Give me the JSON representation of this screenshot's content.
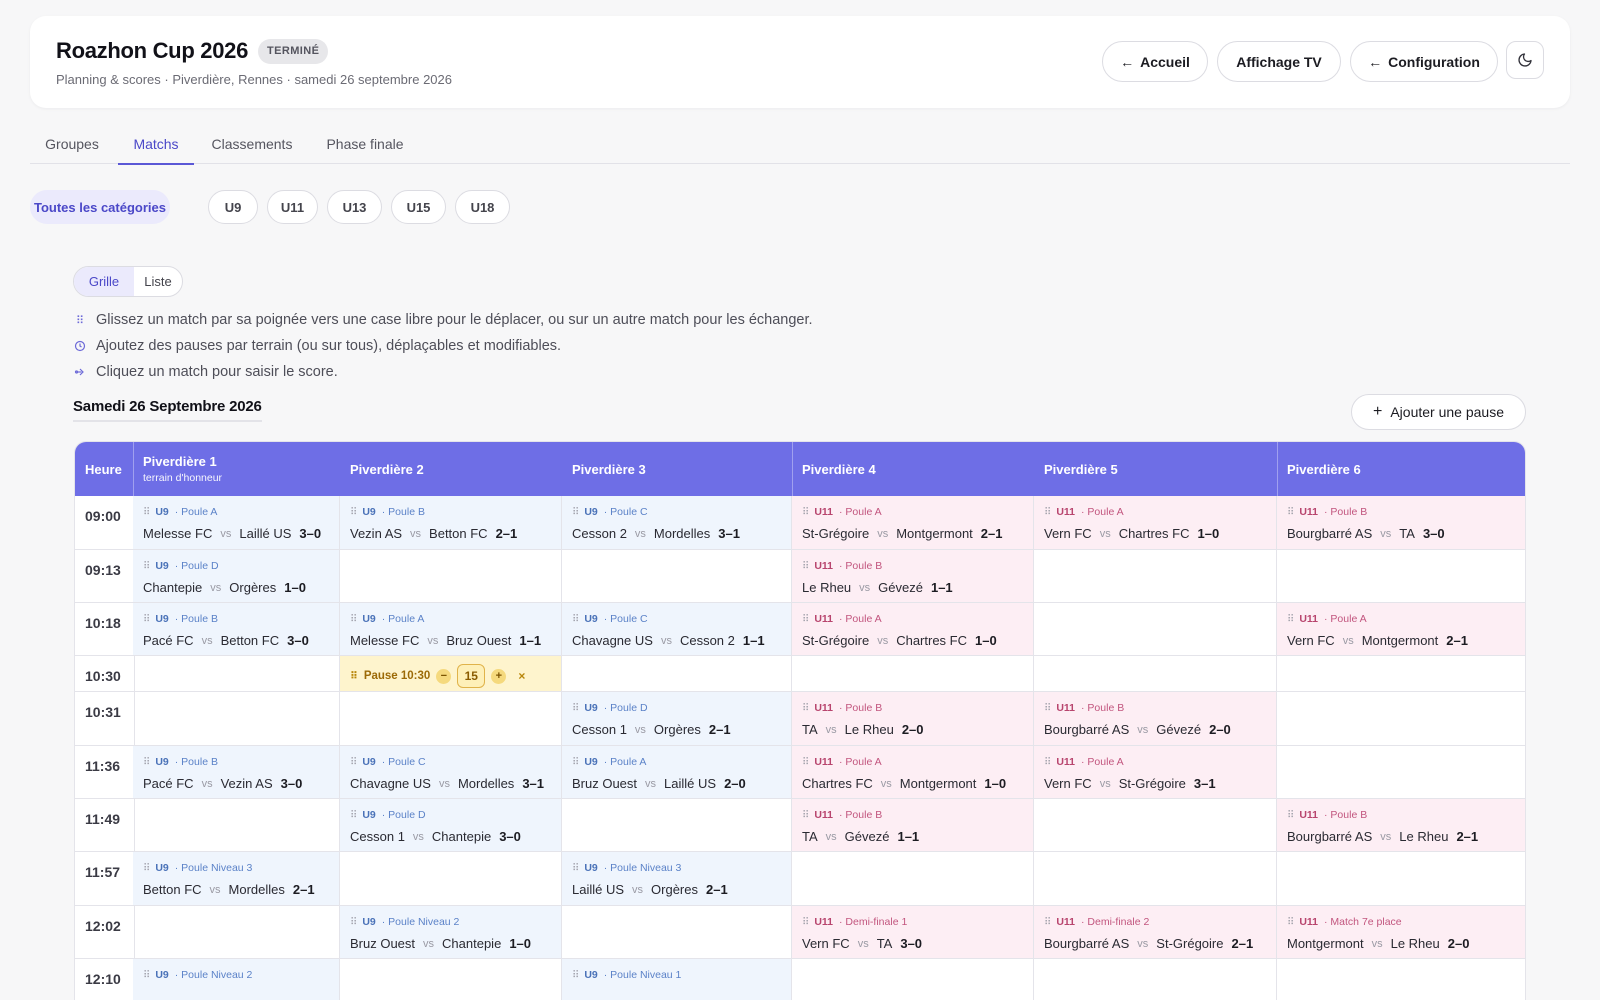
{
  "header": {
    "title": "Roazhon Cup 2026",
    "status": "TERMINÉ",
    "subtitle": "Planning & scores · Piverdière, Rennes · samedi 26 septembre 2026",
    "btn_home": "Accueil",
    "btn_tv": "Affichage TV",
    "btn_config": "Configuration",
    "theme_icon": "moon-icon"
  },
  "tabs": [
    "Groupes",
    "Matchs",
    "Classements",
    "Phase finale"
  ],
  "active_tab": "Matchs",
  "categories": [
    "Toutes les catégories",
    "U9",
    "U11",
    "U13",
    "U15",
    "U18"
  ],
  "view_toggle": {
    "grid": "Grille",
    "list": "Liste"
  },
  "hints": [
    "Glissez un match par sa poignée vers une case libre pour le déplacer, ou sur un autre match pour les échanger.",
    "Ajoutez des pauses par terrain (ou sur tous), déplaçables et modifiables.",
    "Cliquez un match pour saisir le score."
  ],
  "day_title": "Samedi 26 Septembre 2026",
  "add_pause": "Ajouter une pause",
  "grid": {
    "time_header": "Heure",
    "fields": [
      {
        "name": "Piverdière 1",
        "sub": "terrain d'honneur"
      },
      {
        "name": "Piverdière 2",
        "sub": ""
      },
      {
        "name": "Piverdière 3",
        "sub": ""
      },
      {
        "name": "Piverdière 4",
        "sub": ""
      },
      {
        "name": "Piverdière 5",
        "sub": ""
      },
      {
        "name": "Piverdière 6",
        "sub": ""
      }
    ],
    "vs_label": "vs",
    "rows": [
      {
        "time": "09:00",
        "cells": [
          {
            "cat": "U9",
            "group": "Poule A",
            "home": "Melesse FC",
            "away": "Laillé US",
            "score": "3–0"
          },
          {
            "cat": "U9",
            "group": "Poule B",
            "home": "Vezin AS",
            "away": "Betton FC",
            "score": "2–1"
          },
          {
            "cat": "U9",
            "group": "Poule C",
            "home": "Cesson 2",
            "away": "Mordelles",
            "score": "3–1"
          },
          {
            "cat": "U11",
            "group": "Poule A",
            "home": "St-Grégoire",
            "away": "Montgermont",
            "score": "2–1"
          },
          {
            "cat": "U11",
            "group": "Poule A",
            "home": "Vern FC",
            "away": "Chartres FC",
            "score": "1–0"
          },
          {
            "cat": "U11",
            "group": "Poule B",
            "home": "Bourgbarré AS",
            "away": "TA",
            "score": "3–0"
          }
        ]
      },
      {
        "time": "09:13",
        "cells": [
          {
            "cat": "U9",
            "group": "Poule D",
            "home": "Chantepie",
            "away": "Orgères",
            "score": "1–0"
          },
          null,
          null,
          {
            "cat": "U11",
            "group": "Poule B",
            "home": "Le Rheu",
            "away": "Gévezé",
            "score": "1–1"
          },
          null,
          null
        ]
      },
      {
        "time": "10:18",
        "cells": [
          {
            "cat": "U9",
            "group": "Poule B",
            "home": "Pacé FC",
            "away": "Betton FC",
            "score": "3–0"
          },
          {
            "cat": "U9",
            "group": "Poule A",
            "home": "Melesse FC",
            "away": "Bruz Ouest",
            "score": "1–1"
          },
          {
            "cat": "U9",
            "group": "Poule C",
            "home": "Chavagne US",
            "away": "Cesson 2",
            "score": "1–1"
          },
          {
            "cat": "U11",
            "group": "Poule A",
            "home": "St-Grégoire",
            "away": "Chartres FC",
            "score": "1–0"
          },
          null,
          {
            "cat": "U11",
            "group": "Poule A",
            "home": "Vern FC",
            "away": "Montgermont",
            "score": "2–1"
          }
        ]
      },
      {
        "time": "10:30",
        "pause": {
          "field": 1,
          "label": "Pause 10:30",
          "minutes": "15",
          "minus": "−",
          "plus": "+",
          "remove": "×"
        }
      },
      {
        "time": "10:31",
        "cells": [
          null,
          null,
          {
            "cat": "U9",
            "group": "Poule D",
            "home": "Cesson 1",
            "away": "Orgères",
            "score": "2–1"
          },
          {
            "cat": "U11",
            "group": "Poule B",
            "home": "TA",
            "away": "Le Rheu",
            "score": "2–0"
          },
          {
            "cat": "U11",
            "group": "Poule B",
            "home": "Bourgbarré AS",
            "away": "Gévezé",
            "score": "2–0"
          },
          null
        ]
      },
      {
        "time": "11:36",
        "cells": [
          {
            "cat": "U9",
            "group": "Poule B",
            "home": "Pacé FC",
            "away": "Vezin AS",
            "score": "3–0"
          },
          {
            "cat": "U9",
            "group": "Poule C",
            "home": "Chavagne US",
            "away": "Mordelles",
            "score": "3–1"
          },
          {
            "cat": "U9",
            "group": "Poule A",
            "home": "Bruz Ouest",
            "away": "Laillé US",
            "score": "2–0"
          },
          {
            "cat": "U11",
            "group": "Poule A",
            "home": "Chartres FC",
            "away": "Montgermont",
            "score": "1–0"
          },
          {
            "cat": "U11",
            "group": "Poule A",
            "home": "Vern FC",
            "away": "St-Grégoire",
            "score": "3–1"
          },
          null
        ]
      },
      {
        "time": "11:49",
        "cells": [
          null,
          {
            "cat": "U9",
            "group": "Poule D",
            "home": "Cesson 1",
            "away": "Chantepie",
            "score": "3–0"
          },
          null,
          {
            "cat": "U11",
            "group": "Poule B",
            "home": "TA",
            "away": "Gévezé",
            "score": "1–1"
          },
          null,
          {
            "cat": "U11",
            "group": "Poule B",
            "home": "Bourgbarré AS",
            "away": "Le Rheu",
            "score": "2–1"
          }
        ]
      },
      {
        "time": "11:57",
        "cells": [
          {
            "cat": "U9",
            "group": "Poule Niveau 3",
            "home": "Betton FC",
            "away": "Mordelles",
            "score": "2–1"
          },
          null,
          {
            "cat": "U9",
            "group": "Poule Niveau 3",
            "home": "Laillé US",
            "away": "Orgères",
            "score": "2–1"
          },
          null,
          null,
          null
        ]
      },
      {
        "time": "12:02",
        "cells": [
          null,
          {
            "cat": "U9",
            "group": "Poule Niveau 2",
            "home": "Bruz Ouest",
            "away": "Chantepie",
            "score": "1–0"
          },
          null,
          {
            "cat": "U11",
            "group": "Demi-finale 1",
            "home": "Vern FC",
            "away": "TA",
            "score": "3–0"
          },
          {
            "cat": "U11",
            "group": "Demi-finale 2",
            "home": "Bourgbarré AS",
            "away": "St-Grégoire",
            "score": "2–1"
          },
          {
            "cat": "U11",
            "group": "Match 7e place",
            "home": "Montgermont",
            "away": "Le Rheu",
            "score": "2–0"
          }
        ]
      },
      {
        "time": "12:10",
        "cells": [
          {
            "cat": "U9",
            "group": "Poule Niveau 2",
            "home": "",
            "away": "",
            "score": ""
          },
          null,
          {
            "cat": "U9",
            "group": "Poule Niveau 1",
            "home": "",
            "away": "",
            "score": ""
          },
          null,
          null,
          null
        ]
      }
    ]
  }
}
